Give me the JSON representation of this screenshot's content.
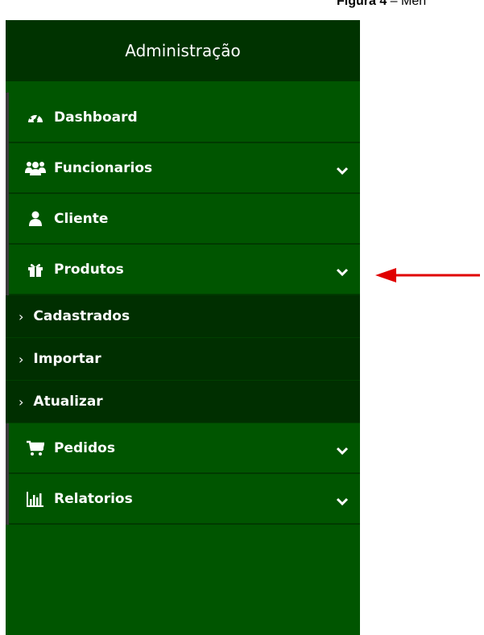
{
  "caption": {
    "prefix": "Figura 4",
    "rest": " – Men"
  },
  "sidebar": {
    "title": "Administração",
    "items": [
      {
        "label": "Dashboard",
        "icon": "dashboard-gauge-icon",
        "expandable": false
      },
      {
        "label": "Funcionarios",
        "icon": "users-icon",
        "expandable": true
      },
      {
        "label": "Cliente",
        "icon": "user-icon",
        "expandable": false
      },
      {
        "label": "Produtos",
        "icon": "gift-icon",
        "expandable": true,
        "expanded": true,
        "subitems": [
          "Cadastrados",
          "Importar",
          "Atualizar"
        ]
      },
      {
        "label": "Pedidos",
        "icon": "cart-icon",
        "expandable": true
      },
      {
        "label": "Relatorios",
        "icon": "bar-chart-icon",
        "expandable": true
      }
    ]
  },
  "colors": {
    "sidebar_bg": "#005500",
    "header_bg": "#003300",
    "submenu_bg": "#002f00",
    "arrow": "#e00000"
  }
}
